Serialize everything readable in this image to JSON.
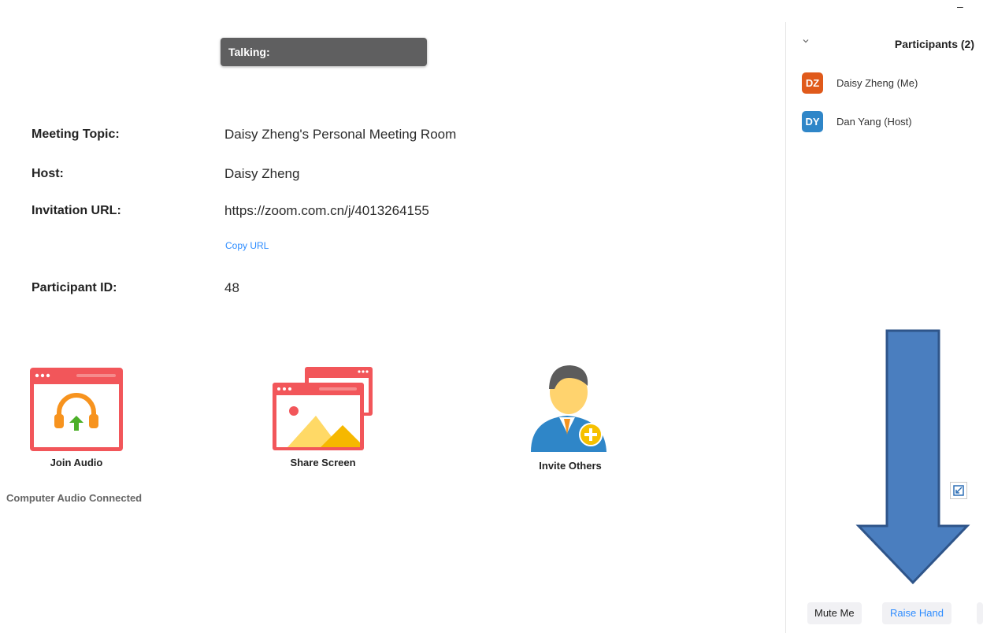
{
  "window": {
    "minimize_glyph": "–"
  },
  "talking": {
    "label": "Talking:"
  },
  "meeting": {
    "topic_label": "Meeting Topic:",
    "topic_value": "Daisy Zheng's Personal Meeting Room",
    "host_label": "Host:",
    "host_value": "Daisy Zheng",
    "url_label": "Invitation URL:",
    "url_value": "https://zoom.com.cn/j/4013264155",
    "copy_url": "Copy URL",
    "participant_id_label": "Participant ID:",
    "participant_id_value": "48"
  },
  "actions": {
    "join_audio": {
      "label": "Join Audio",
      "sub": "Computer Audio Connected",
      "icon": "join-audio-icon"
    },
    "share_screen": {
      "label": "Share Screen",
      "icon": "share-screen-icon"
    },
    "invite_others": {
      "label": "Invite Others",
      "icon": "invite-others-icon"
    }
  },
  "participants": {
    "title": "Participants (2)",
    "list": [
      {
        "initials": "DZ",
        "name": "Daisy Zheng (Me)",
        "color": "#e05a1b"
      },
      {
        "initials": "DY",
        "name": "Dan Yang (Host)",
        "color": "#2f86c8"
      }
    ],
    "buttons": {
      "mute": "Mute Me",
      "raise": "Raise Hand"
    }
  },
  "colors": {
    "accent": "#2d8cff",
    "arrow_fill": "#4a7ebf",
    "arrow_stroke": "#2f558a",
    "icon_red": "#f2565a",
    "icon_orange": "#f7931e"
  }
}
